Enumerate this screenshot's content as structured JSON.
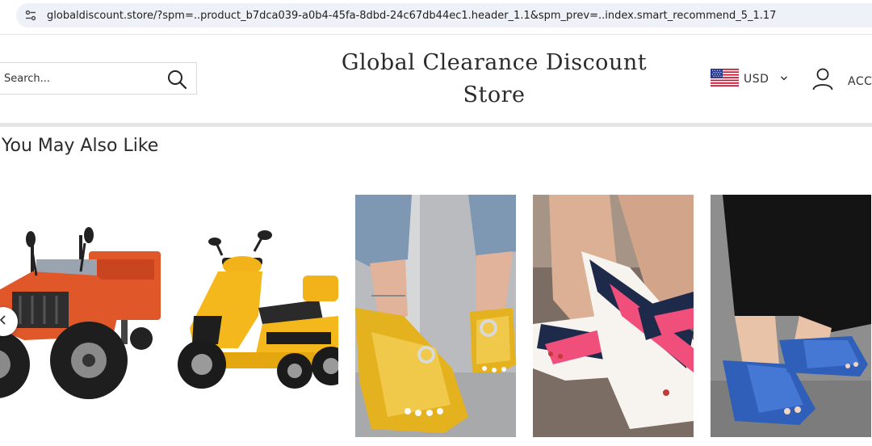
{
  "browser": {
    "url": "globaldiscount.store/?spm=..product_b7dca039-a0b4-45fa-8dbd-24c67db44ec1.header_1.1&spm_prev=..index.smart_recommend_5_1.17",
    "site_info_icon": "tune-icon"
  },
  "header": {
    "search": {
      "placeholder": "Search..."
    },
    "store_name": "Global Clearance Discount Store",
    "currency": {
      "label": "USD",
      "flag": "us-flag-icon"
    },
    "account_label": "ACCOUNT"
  },
  "recommendations": {
    "title": "You May Also Like",
    "products": [
      {
        "subject": "red atv with cargo trailer"
      },
      {
        "subject": "yellow mobility scooter"
      },
      {
        "subject": "yellow thong sandals"
      },
      {
        "subject": "pink navy cross-strap sandals"
      },
      {
        "subject": "blue orthopedic slide sandals"
      }
    ]
  },
  "colors": {
    "accent_text": "#2b2b2b",
    "border": "#d9d9d9",
    "urlbar_bg": "#eef1f7"
  }
}
